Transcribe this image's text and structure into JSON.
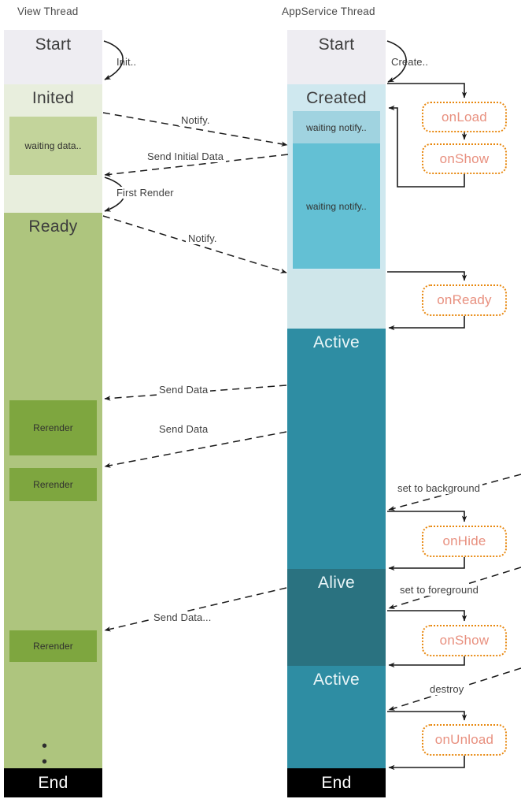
{
  "diagram": {
    "title_left": "View Thread",
    "title_right": "AppService Thread",
    "colors": {
      "start": "#eeedf2",
      "inited": "#e8eedd",
      "waiting_data": "#c3d49b",
      "ready": "#aec57e",
      "rerender": "#7ea63f",
      "created": "#cfe8ef",
      "waiting_notify_light": "#a0d3e0",
      "waiting_notify_dark": "#63c0d4",
      "ready_pause": "#cfe6ea",
      "active": "#2e8da3",
      "alive": "#2a7280",
      "end": "#000000",
      "callback_border": "#e8880f",
      "callback_text": "#e8907f",
      "arrow": "#1a1a1a"
    }
  },
  "view_thread": {
    "states": [
      {
        "name": "Start",
        "label": "Start"
      },
      {
        "name": "Inited",
        "label": "Inited"
      },
      {
        "name": "Ready",
        "label": "Ready"
      },
      {
        "name": "End",
        "label": "End"
      }
    ],
    "inner_blocks": [
      {
        "name": "waiting-data",
        "label": "waiting data.."
      },
      {
        "name": "rerender-1",
        "label": "Rerender"
      },
      {
        "name": "rerender-2",
        "label": "Rerender"
      },
      {
        "name": "rerender-3",
        "label": "Rerender"
      }
    ],
    "ellipsis": "• • •"
  },
  "appservice_thread": {
    "states": [
      {
        "name": "Start",
        "label": "Start"
      },
      {
        "name": "Created",
        "label": "Created"
      },
      {
        "name": "Active",
        "label": "Active"
      },
      {
        "name": "Alive",
        "label": "Alive"
      },
      {
        "name": "Active2",
        "label": "Active"
      },
      {
        "name": "End",
        "label": "End"
      }
    ],
    "inner_blocks": [
      {
        "name": "waiting-notify-1",
        "label": "waiting notify.."
      },
      {
        "name": "waiting-notify-2",
        "label": "waiting notify.."
      }
    ]
  },
  "callbacks": [
    {
      "name": "onLoad",
      "label": "onLoad"
    },
    {
      "name": "onShow",
      "label": "onShow"
    },
    {
      "name": "onReady",
      "label": "onReady"
    },
    {
      "name": "onHide",
      "label": "onHide"
    },
    {
      "name": "onShow2",
      "label": "onShow"
    },
    {
      "name": "onUnload",
      "label": "onUnload"
    }
  ],
  "edges": [
    {
      "name": "init",
      "label": "Init.."
    },
    {
      "name": "create",
      "label": "Create.."
    },
    {
      "name": "notify-1",
      "label": "Notify."
    },
    {
      "name": "send-initial-data",
      "label": "Send Initial Data"
    },
    {
      "name": "first-render",
      "label": "First Render"
    },
    {
      "name": "notify-2",
      "label": "Notify."
    },
    {
      "name": "send-data-1",
      "label": "Send Data"
    },
    {
      "name": "send-data-2",
      "label": "Send Data"
    },
    {
      "name": "send-data-3",
      "label": "Send Data"
    },
    {
      "name": "send-data-4",
      "label": "Send Data..."
    },
    {
      "name": "set-to-background",
      "label": "set to background"
    },
    {
      "name": "set-to-foreground",
      "label": "set to foreground"
    },
    {
      "name": "destroy",
      "label": "destroy"
    }
  ]
}
